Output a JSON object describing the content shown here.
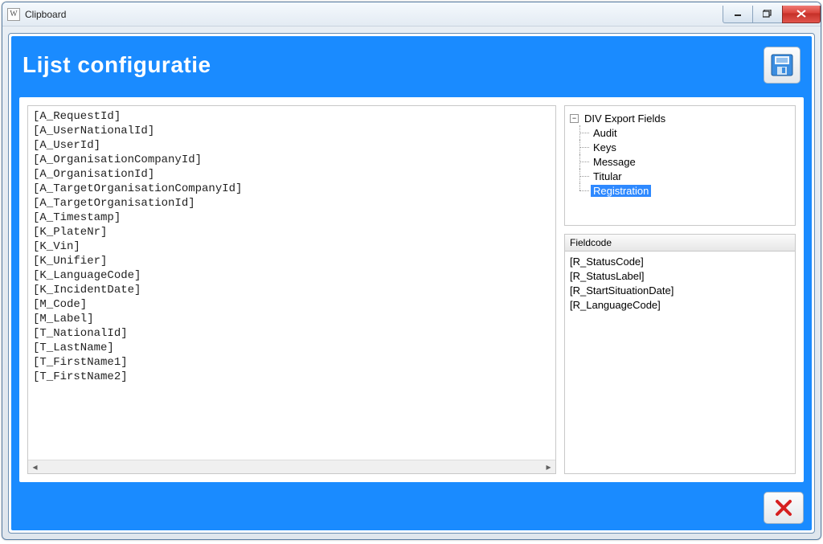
{
  "window": {
    "app_icon_letter": "W",
    "title": "Clipboard"
  },
  "header": {
    "title": "Lijst configuratie"
  },
  "editor": {
    "lines": [
      "[A_RequestId]",
      "[A_UserNationalId]",
      "[A_UserId]",
      "[A_OrganisationCompanyId]",
      "[A_OrganisationId]",
      "[A_TargetOrganisationCompanyId]",
      "[A_TargetOrganisationId]",
      "[A_Timestamp]",
      "[K_PlateNr]",
      "[K_Vin]",
      "[K_Unifier]",
      "[K_LanguageCode]",
      "[K_IncidentDate]",
      "[M_Code]",
      "[M_Label]",
      "[T_NationalId]",
      "[T_LastName]",
      "[T_FirstName1]",
      "[T_FirstName2]"
    ]
  },
  "tree": {
    "root": "DIV Export Fields",
    "children": [
      {
        "label": "Audit",
        "selected": false
      },
      {
        "label": "Keys",
        "selected": false
      },
      {
        "label": "Message",
        "selected": false
      },
      {
        "label": "Titular",
        "selected": false
      },
      {
        "label": "Registration",
        "selected": true
      }
    ]
  },
  "fieldgrid": {
    "header": "Fieldcode",
    "rows": [
      "[R_StatusCode]",
      "[R_StatusLabel]",
      "[R_StartSituationDate]",
      "[R_LanguageCode]"
    ]
  }
}
